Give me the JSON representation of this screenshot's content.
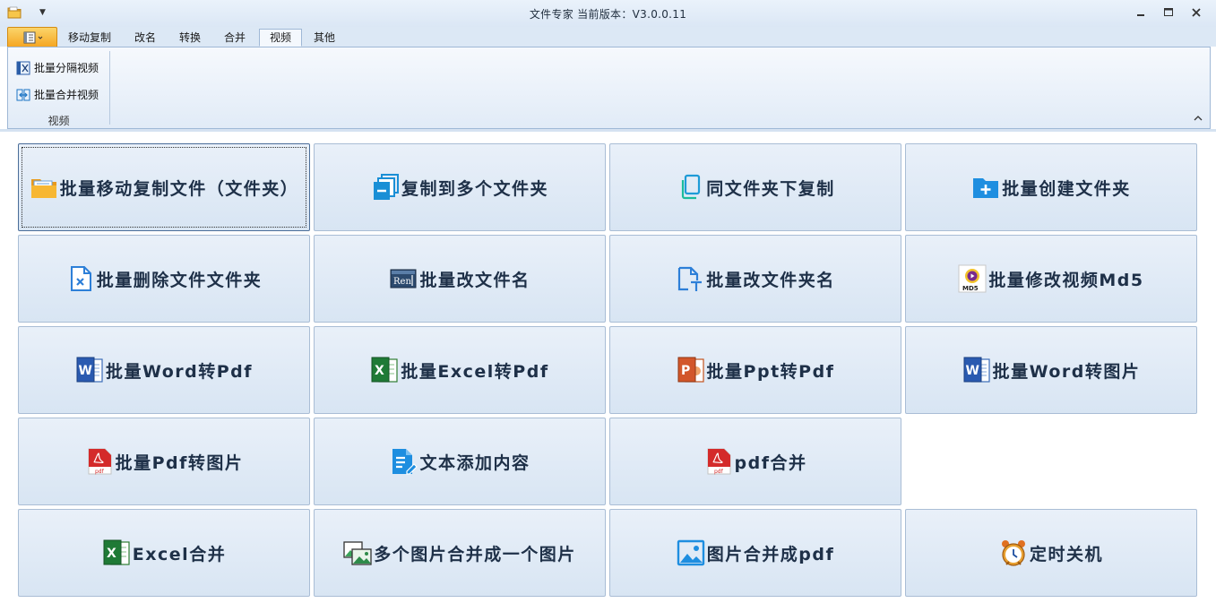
{
  "window": {
    "title": "文件专家   当前版本：V3.0.0.11"
  },
  "tabs": [
    {
      "label": "移动复制"
    },
    {
      "label": "改名"
    },
    {
      "label": "转换"
    },
    {
      "label": "合并"
    },
    {
      "label": "视频"
    },
    {
      "label": "其他"
    }
  ],
  "ribbon": {
    "buttons": [
      {
        "label": "批量分隔视频",
        "icon": "video-split-icon"
      },
      {
        "label": "批量合并视频",
        "icon": "video-merge-icon"
      }
    ],
    "group_label": "视频"
  },
  "tiles": [
    {
      "label": "批量移动复制文件（文件夹）",
      "icon": "folder-icon"
    },
    {
      "label": "复制到多个文件夹",
      "icon": "multi-copy-icon"
    },
    {
      "label": "同文件夹下复制",
      "icon": "copy-icon"
    },
    {
      "label": "批量创建文件夹",
      "icon": "folder-add-icon"
    },
    {
      "label": "批量删除文件文件夹",
      "icon": "file-delete-icon"
    },
    {
      "label": "批量改文件名",
      "icon": "rename-icon",
      "icon_text": "Ren"
    },
    {
      "label": "批量改文件夹名",
      "icon": "folder-rename-icon"
    },
    {
      "label": "批量修改视频Md5",
      "icon": "md5-icon",
      "icon_text": "MD5"
    },
    {
      "label": "批量Word转Pdf",
      "icon": "word-icon",
      "icon_text": "W"
    },
    {
      "label": "批量Excel转Pdf",
      "icon": "excel-icon",
      "icon_text": "X"
    },
    {
      "label": "批量Ppt转Pdf",
      "icon": "ppt-icon",
      "icon_text": "P"
    },
    {
      "label": "批量Word转图片",
      "icon": "word-icon",
      "icon_text": "W"
    },
    {
      "label": "批量Pdf转图片",
      "icon": "pdf-icon",
      "icon_text": "pdf"
    },
    {
      "label": "文本添加内容",
      "icon": "text-edit-icon"
    },
    {
      "label": "pdf合并",
      "icon": "pdf-icon",
      "icon_text": "pdf"
    },
    {
      "label": "Excel合并",
      "icon": "excel-icon",
      "icon_text": "X"
    },
    {
      "label": "多个图片合并成一个图片",
      "icon": "image-merge-icon"
    },
    {
      "label": "图片合并成pdf",
      "icon": "image-icon"
    },
    {
      "label": "定时关机",
      "icon": "alarm-clock-icon"
    }
  ]
}
